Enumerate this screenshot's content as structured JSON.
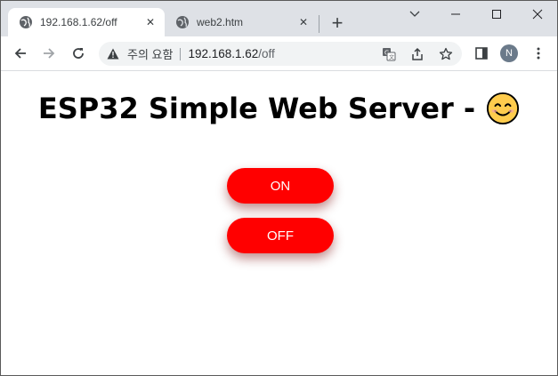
{
  "browser": {
    "tabs": [
      {
        "title": "192.168.1.62/off",
        "active": true
      },
      {
        "title": "web2.htm",
        "active": false
      }
    ],
    "address": {
      "security_label": "주의 요함",
      "host": "192.168.1.62",
      "path": "/off"
    },
    "profile_initial": "N"
  },
  "page": {
    "heading": "ESP32 Simple Web Server -",
    "buttons": {
      "on_label": "ON",
      "off_label": "OFF"
    }
  },
  "colors": {
    "button_bg": "#ff0000",
    "button_text": "#ffffff"
  }
}
